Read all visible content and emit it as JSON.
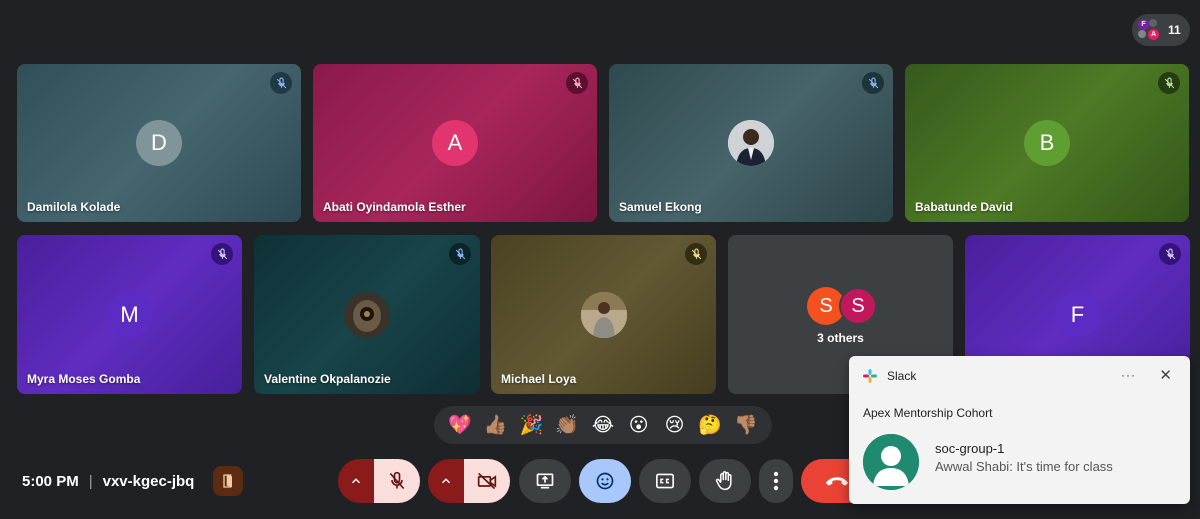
{
  "participants_count": "11",
  "participants_mini": [
    "F",
    "A"
  ],
  "tiles": [
    {
      "name": "Damilola Kolade",
      "initial": "D"
    },
    {
      "name": "Abati Oyindamola Esther",
      "initial": "A"
    },
    {
      "name": "Samuel Ekong",
      "initial": ""
    },
    {
      "name": "Babatunde David",
      "initial": "B"
    },
    {
      "name": "Myra Moses Gomba",
      "initial": "M"
    },
    {
      "name": "Valentine Okpalanozie",
      "initial": ""
    },
    {
      "name": "Michael Loya",
      "initial": ""
    },
    {
      "name": "",
      "initial": "F"
    }
  ],
  "others": {
    "initials": [
      "S",
      "S"
    ],
    "label": "3 others"
  },
  "reactions": [
    "💖",
    "👍🏽",
    "🎉",
    "👏🏽",
    "😂",
    "😮",
    "😢",
    "🤔",
    "👎🏽"
  ],
  "meeting": {
    "time": "5:00 PM",
    "separator": "|",
    "code": "vxv-kgec-jbq"
  },
  "colors": {
    "background": "#202124",
    "end_call": "#ea4335",
    "emoji_active": "#a8c7fa"
  },
  "notification": {
    "app": "Slack",
    "more": "···",
    "close": "✕",
    "group": "Apex Mentorship Cohort",
    "title": "soc-group-1",
    "message": "Awwal Shabi: It's time for class"
  }
}
